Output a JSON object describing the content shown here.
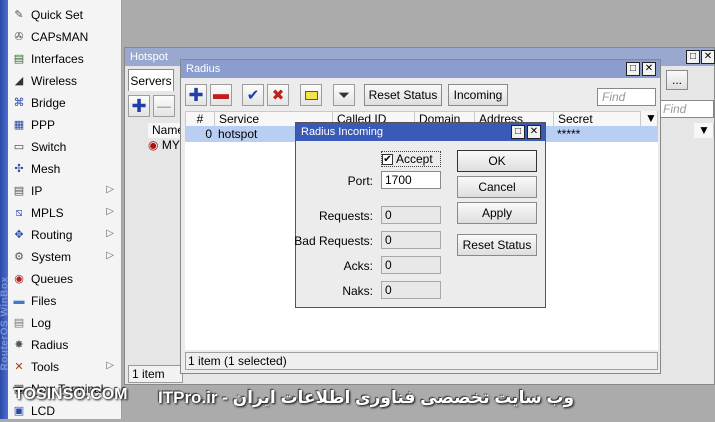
{
  "sidebar": {
    "vertical_brand": "RouterOS WinBox",
    "items": [
      {
        "label": "Quick Set",
        "icon": "quick-set-icon",
        "submenu": false
      },
      {
        "label": "CAPsMAN",
        "icon": "capsman-icon",
        "submenu": false
      },
      {
        "label": "Interfaces",
        "icon": "interfaces-icon",
        "submenu": false
      },
      {
        "label": "Wireless",
        "icon": "wireless-icon",
        "submenu": false
      },
      {
        "label": "Bridge",
        "icon": "bridge-icon",
        "submenu": false
      },
      {
        "label": "PPP",
        "icon": "ppp-icon",
        "submenu": false
      },
      {
        "label": "Switch",
        "icon": "switch-icon",
        "submenu": false
      },
      {
        "label": "Mesh",
        "icon": "mesh-icon",
        "submenu": false
      },
      {
        "label": "IP",
        "icon": "ip-icon",
        "submenu": true
      },
      {
        "label": "MPLS",
        "icon": "mpls-icon",
        "submenu": true
      },
      {
        "label": "Routing",
        "icon": "routing-icon",
        "submenu": true
      },
      {
        "label": "System",
        "icon": "system-icon",
        "submenu": true
      },
      {
        "label": "Queues",
        "icon": "queues-icon",
        "submenu": false
      },
      {
        "label": "Files",
        "icon": "files-icon",
        "submenu": false
      },
      {
        "label": "Log",
        "icon": "log-icon",
        "submenu": false
      },
      {
        "label": "Radius",
        "icon": "radius-icon",
        "submenu": false
      },
      {
        "label": "Tools",
        "icon": "tools-icon",
        "submenu": true
      },
      {
        "label": "New Terminal",
        "icon": "terminal-icon",
        "submenu": false
      },
      {
        "label": "LCD",
        "icon": "lcd-icon",
        "submenu": false
      }
    ]
  },
  "hotspot": {
    "title": "Hotspot",
    "tab": "Servers",
    "col_name": "Name",
    "row_name": "MY",
    "find_placeholder": "Find",
    "more": "...",
    "status": "1 item"
  },
  "radius": {
    "title": "Radius",
    "toolbar": {
      "reset_status": "Reset Status",
      "incoming": "Incoming"
    },
    "find_placeholder": "Find",
    "columns": [
      "#",
      "Service",
      "Called ID",
      "Domain",
      "Address",
      "Secret"
    ],
    "rows": [
      {
        "num": "0",
        "service": "hotspot",
        "called_id": "",
        "domain": "",
        "address": "",
        "secret": "*****"
      }
    ],
    "status": "1 item (1 selected)"
  },
  "dialog": {
    "title": "Radius Incoming",
    "accept_label": "Accept",
    "accept_checked": true,
    "port_label": "Port:",
    "port_value": "1700",
    "requests_label": "Requests:",
    "requests_value": "0",
    "bad_requests_label": "Bad Requests:",
    "bad_requests_value": "0",
    "acks_label": "Acks:",
    "acks_value": "0",
    "naks_label": "Naks:",
    "naks_value": "0",
    "ok": "OK",
    "cancel": "Cancel",
    "apply": "Apply",
    "reset_status": "Reset Status"
  },
  "watermark": {
    "left": "TOSINSO.COM",
    "right": "وب سایت تخصصی فناوری اطلاعات ایران - ITPro.ir"
  },
  "colors": {
    "titlebar_blue": "#6d85c8",
    "dialog_title_blue": "#3a5ab8",
    "selection": "#b8cef2",
    "add_blue": "#1f3ea8",
    "remove_red": "#c0201a"
  }
}
